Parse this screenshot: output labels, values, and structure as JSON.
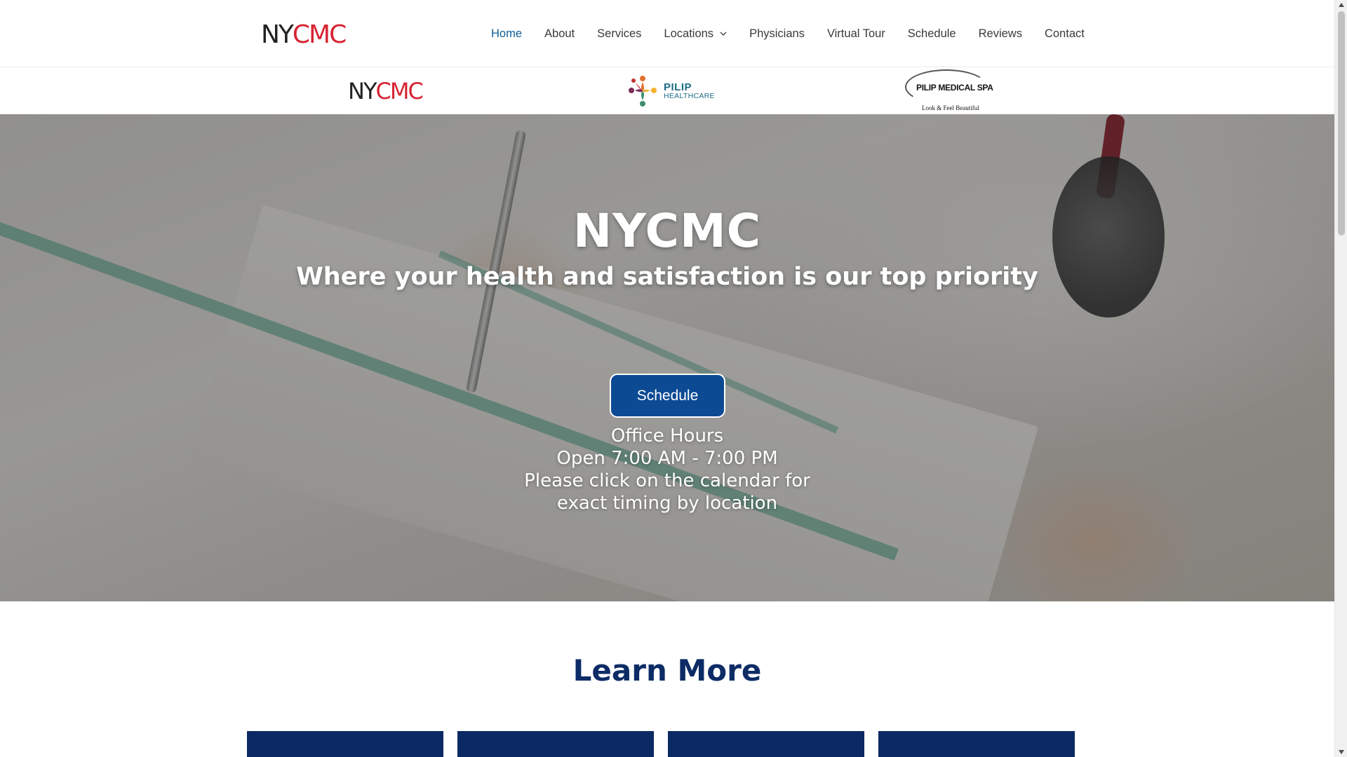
{
  "header": {
    "logo": {
      "part1": "NY",
      "part2": "CMC"
    },
    "nav": [
      {
        "label": "Home",
        "active": true
      },
      {
        "label": "About"
      },
      {
        "label": "Services"
      },
      {
        "label": "Locations",
        "has_dropdown": true
      },
      {
        "label": "Physicians"
      },
      {
        "label": "Virtual Tour"
      },
      {
        "label": "Schedule"
      },
      {
        "label": "Reviews"
      },
      {
        "label": "Contact"
      }
    ]
  },
  "brands": {
    "nycmc": {
      "part1": "NY",
      "part2": "CMC"
    },
    "pilip": {
      "line1": "PILIP",
      "line2": "HEALTHCARE"
    },
    "spa": {
      "name": "PILIP MEDICAL SPA",
      "tagline": "Look & Feel Beautiful"
    }
  },
  "hero": {
    "title": "NYCMC",
    "subtitle": "Where your health and satisfaction is our top priority",
    "button_label": "Schedule",
    "hours": [
      "Office Hours",
      "Open 7:00 AM - 7:00 PM",
      "Please click on the calendar for",
      "exact timing by location"
    ]
  },
  "learn_more": {
    "title": "Learn More"
  },
  "colors": {
    "accent_nav": "#0f5c96",
    "button_bg": "#0d4a94",
    "heading_navy": "#0d2c66",
    "card_navy": "#0b2a63",
    "logo_red": "#d72333"
  },
  "icons": {
    "dropdown": "chevron-down-icon"
  }
}
